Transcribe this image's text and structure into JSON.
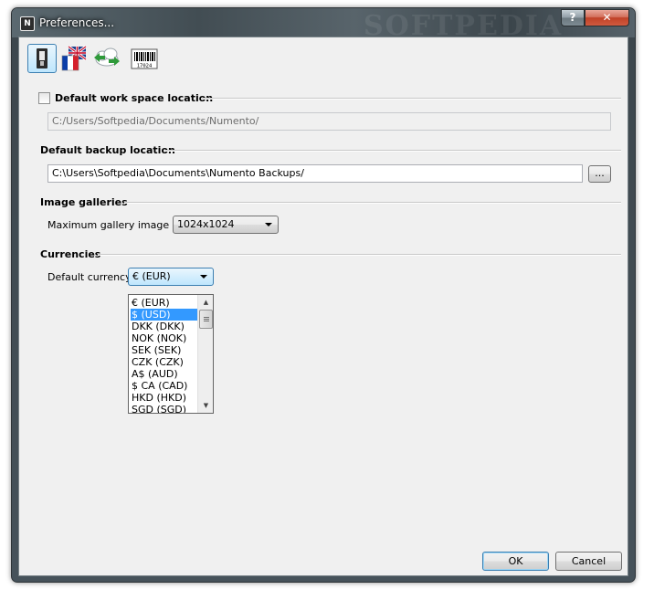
{
  "window": {
    "title": "Preferences...",
    "app_icon": "numento-icon",
    "watermark": "SOFTPEDIA"
  },
  "titlebar": {
    "help": "?",
    "close": "✕"
  },
  "toolbar": [
    {
      "name": "general-settings-icon",
      "active": true
    },
    {
      "name": "language-flags-icon",
      "active": false
    },
    {
      "name": "sync-cloud-icon",
      "active": false
    },
    {
      "name": "barcode-icon",
      "active": false,
      "text": "17024"
    }
  ],
  "workspace": {
    "label": "Default work space location",
    "checked": false,
    "path": "C:/Users/Softpedia/Documents/Numento/"
  },
  "backup": {
    "label": "Default backup location",
    "path": "C:\\Users\\Softpedia\\Documents\\Numento Backups/",
    "browse": "..."
  },
  "galleries": {
    "label": "Image galleries",
    "size_label": "Maximum gallery image size",
    "size_value": "1024x1024"
  },
  "currencies": {
    "label": "Currencies",
    "default_label": "Default currency",
    "current": "€ (EUR)",
    "options": [
      "€ (EUR)",
      "$ (USD)",
      "DKK (DKK)",
      "NOK (NOK)",
      "SEK (SEK)",
      "CZK (CZK)",
      "A$ (AUD)",
      "$ CA (CAD)",
      "HKD (HKD)",
      "SGD (SGD)"
    ],
    "highlighted": "$ (USD)"
  },
  "buttons": {
    "ok": "OK",
    "cancel": "Cancel"
  }
}
